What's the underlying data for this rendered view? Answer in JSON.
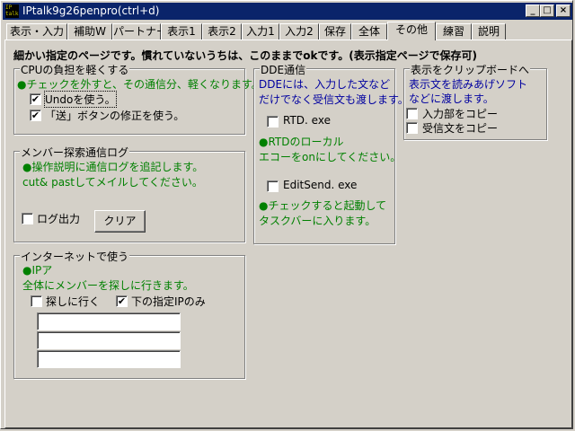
{
  "window": {
    "title": "IPtalk9g26penpro(ctrl+d)",
    "icon_text": "IP talk",
    "controls": {
      "minimize": "_",
      "maximize": "□",
      "close": "×"
    }
  },
  "tabs": [
    {
      "label": "表示・入力"
    },
    {
      "label": "補助W"
    },
    {
      "label": "パートナー"
    },
    {
      "label": "表示1"
    },
    {
      "label": "表示2"
    },
    {
      "label": "入力1"
    },
    {
      "label": "入力2"
    },
    {
      "label": "保存"
    },
    {
      "label": "全体"
    },
    {
      "label": "その他",
      "active": true
    },
    {
      "label": "練習"
    },
    {
      "label": "説明"
    }
  ],
  "heading": "細かい指定のページです。慣れていないうちは、このままでokです。(表示指定ページで保存可)",
  "cpu_group": {
    "title": "CPUの負担を軽くする",
    "note": "●チェックを外すと、その通信分、軽くなります。",
    "undo": {
      "label": "Undoを使う。",
      "checked": true
    },
    "send_fix": {
      "label": "「送」ボタンの修正を使う。",
      "checked": true
    }
  },
  "member_group": {
    "title": "メンバー探索通信ログ",
    "note1": "●操作説明に通信ログを追記します。",
    "note2": "cut& pastしてメイルしてください。",
    "log_output": {
      "label": "ログ出力",
      "checked": false
    },
    "clear_button": "クリア"
  },
  "internet_group": {
    "title": "インターネットで使う",
    "note1": "●IPア",
    "note2": "全体にメンバーを探しに行きます。",
    "search": {
      "label": "探しに行く",
      "checked": false
    },
    "only_ip": {
      "label": "下の指定IPのみ",
      "checked": true
    },
    "ip_fields": [
      "",
      "",
      ""
    ]
  },
  "dde_group": {
    "title": "DDE通信",
    "note1": "DDEには、入力した文など",
    "note2": "だけでなく受信文も渡します。",
    "rtd": {
      "label": "RTD. exe",
      "checked": false
    },
    "rtd_note1": "●RTDのローカル",
    "rtd_note2": "エコーをonにしてください。",
    "editsend": {
      "label": "EditSend. exe",
      "checked": false
    },
    "edit_note1": "●チェックすると起動して",
    "edit_note2": "タスクバーに入ります。"
  },
  "clipboard_group": {
    "title": "表示をクリップボードへ",
    "note1": "表示文を読みあげソフト",
    "note2": "などに渡します。",
    "copy_input": {
      "label": "入力部をコピー",
      "checked": false
    },
    "copy_received": {
      "label": "受信文をコピー",
      "checked": false
    }
  },
  "marks": {
    "checked": "✔",
    "unchecked": ""
  }
}
